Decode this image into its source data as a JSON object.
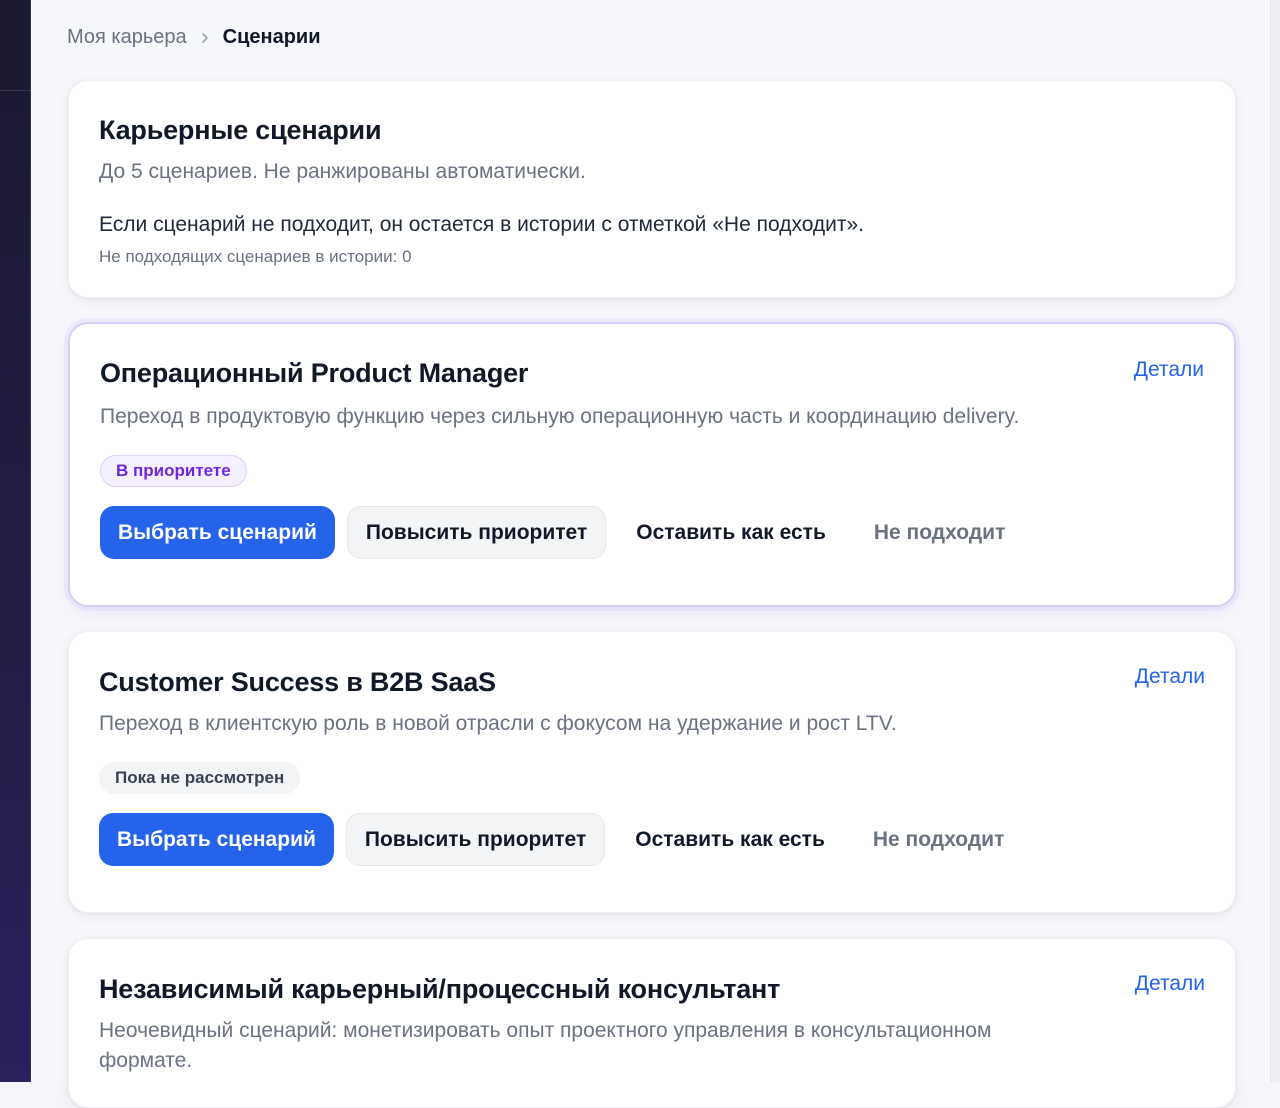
{
  "breadcrumb": {
    "parent": "Моя карьера",
    "current": "Сценарии"
  },
  "intro": {
    "title": "Карьерные сценарии",
    "subtitle": "До 5 сценариев. Не ранжированы автоматически.",
    "note": "Если сценарий не подходит, он остается в истории с отметкой «Не подходит».",
    "history_count": "Не подходящих сценариев в истории: 0"
  },
  "details_label": "Детали",
  "actions": {
    "choose": "Выбрать сценарий",
    "raise": "Повысить приоритет",
    "keep": "Оставить как есть",
    "reject": "Не подходит"
  },
  "scenarios": [
    {
      "title": "Операционный Product Manager",
      "description": "Переход в продуктовую функцию через сильную операционную часть и координацию delivery.",
      "status": "В приоритете"
    },
    {
      "title": "Customer Success в B2B SaaS",
      "description": "Переход в клиентскую роль в новой отрасли с фокусом на удержание и рост LTV.",
      "status": "Пока не рассмотрен"
    },
    {
      "title": "Независимый карьерный/процессный консультант",
      "description": "Неочевидный сценарий: монетизировать опыт проектного управления в консультационном формате."
    }
  ],
  "colors": {
    "accent": "#2563eb",
    "priority_badge": "#6d28d9",
    "sidebar": "#231c44"
  }
}
